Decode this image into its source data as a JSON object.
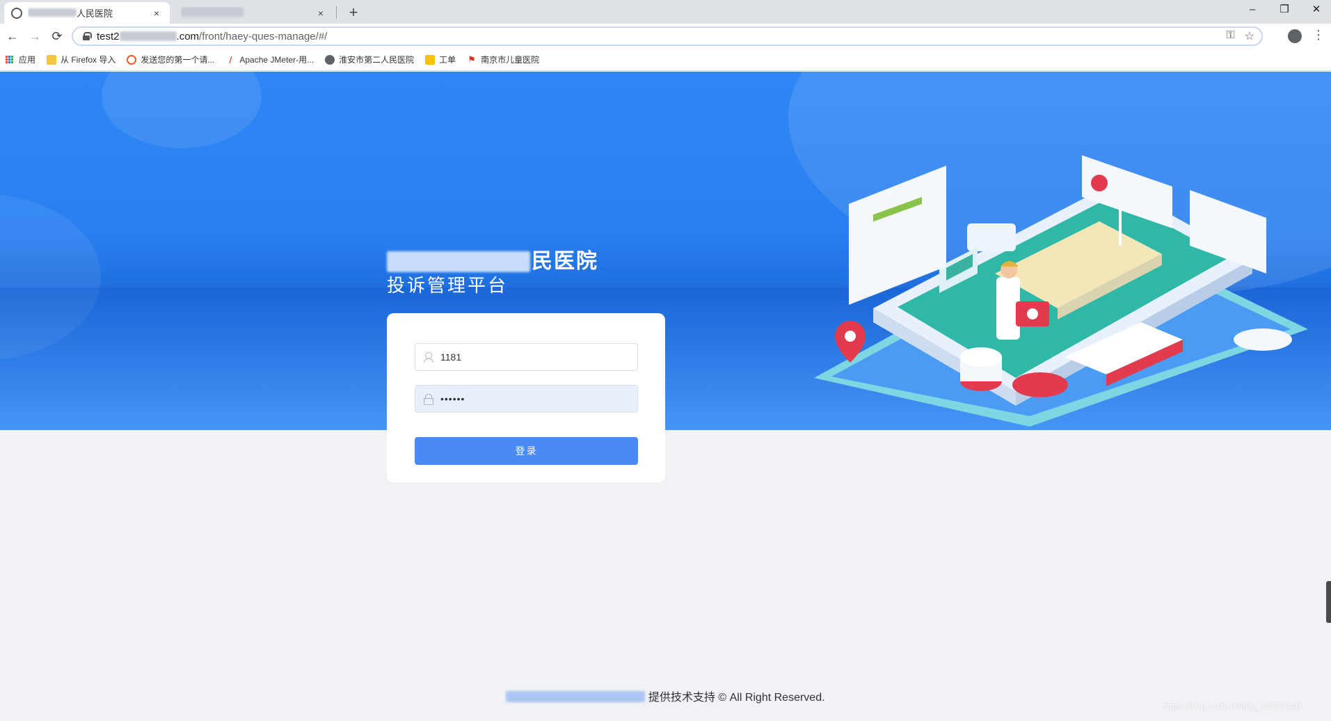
{
  "browser": {
    "tabs": [
      {
        "title": "人民医院",
        "close": "×"
      },
      {
        "title": "",
        "close": "×"
      }
    ],
    "new_tab": "+",
    "window_controls": {
      "minimize": "–",
      "restore": "❐",
      "close": "✕"
    },
    "nav": {
      "back": "←",
      "forward": "→",
      "reload": "⟳"
    },
    "url": {
      "host_prefix": "test2",
      "host_suffix": ".com",
      "path": "/front/haey-ques-manage/#/"
    },
    "omni_icons": {
      "key": "⚿",
      "star": "☆"
    },
    "bookmarks": [
      {
        "label": "应用",
        "icon": "apps-icon"
      },
      {
        "label": "从 Firefox 导入",
        "icon": "folder-icon",
        "color": "#f5c542"
      },
      {
        "label": "发送您的第一个请...",
        "icon": "postman-icon",
        "color": "#ef5b25"
      },
      {
        "label": "Apache JMeter-用...",
        "icon": "feather-icon",
        "color": "#d93025"
      },
      {
        "label": "淮安市第二人民医院",
        "icon": "globe-icon",
        "color": "#5f6368"
      },
      {
        "label": "工单",
        "icon": "ticket-icon",
        "color": "#f4c20d"
      },
      {
        "label": "南京市儿童医院",
        "icon": "flag-icon",
        "color": "#d93025"
      }
    ]
  },
  "hero": {
    "title_suffix": "民医院",
    "subtitle": "投诉管理平台"
  },
  "login": {
    "username_value": "1181",
    "password_value": "••••••",
    "submit_label": "登录"
  },
  "footer": {
    "text": "提供技术支持 © All Right Reserved."
  },
  "watermark": "https://blog.csdn.net/qq_38175040",
  "colors": {
    "hero_blue": "#2f87f5",
    "button_blue": "#4a8af4",
    "page_bg": "#f0f2f5"
  }
}
